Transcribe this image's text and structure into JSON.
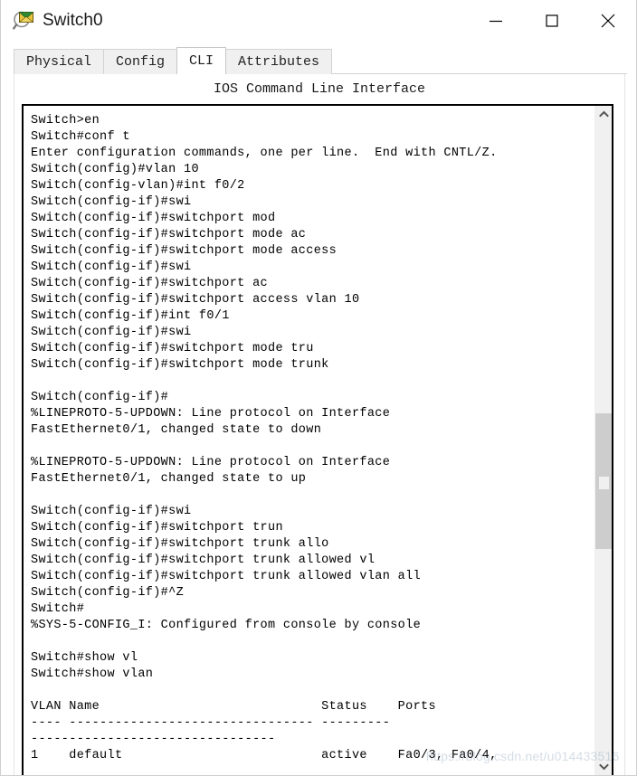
{
  "window": {
    "title": "Switch0",
    "icon": "packet-tracer-device-icon",
    "controls": {
      "minimize": "—",
      "maximize": "□",
      "close": "✕"
    }
  },
  "tabs": [
    {
      "label": "Physical",
      "active": false
    },
    {
      "label": "Config",
      "active": false
    },
    {
      "label": "CLI",
      "active": true
    },
    {
      "label": "Attributes",
      "active": false
    }
  ],
  "panel": {
    "heading": "IOS Command Line Interface"
  },
  "terminal": {
    "lines": [
      "Switch>en",
      "Switch#conf t",
      "Enter configuration commands, one per line.  End with CNTL/Z.",
      "Switch(config)#vlan 10",
      "Switch(config-vlan)#int f0/2",
      "Switch(config-if)#swi",
      "Switch(config-if)#switchport mod",
      "Switch(config-if)#switchport mode ac",
      "Switch(config-if)#switchport mode access",
      "Switch(config-if)#swi",
      "Switch(config-if)#switchport ac",
      "Switch(config-if)#switchport access vlan 10",
      "Switch(config-if)#int f0/1",
      "Switch(config-if)#swi",
      "Switch(config-if)#switchport mode tru",
      "Switch(config-if)#switchport mode trunk",
      "",
      "Switch(config-if)#",
      "%LINEPROTO-5-UPDOWN: Line protocol on Interface",
      "FastEthernet0/1, changed state to down",
      "",
      "%LINEPROTO-5-UPDOWN: Line protocol on Interface",
      "FastEthernet0/1, changed state to up",
      "",
      "Switch(config-if)#swi",
      "Switch(config-if)#switchport trun",
      "Switch(config-if)#switchport trunk allo",
      "Switch(config-if)#switchport trunk allowed vl",
      "Switch(config-if)#switchport trunk allowed vlan all",
      "Switch(config-if)#^Z",
      "Switch#",
      "%SYS-5-CONFIG_I: Configured from console by console",
      "",
      "Switch#show vl",
      "Switch#show vlan",
      "",
      "VLAN Name                             Status    Ports",
      "---- -------------------------------- ---------",
      "--------------------------------",
      "1    default                          active    Fa0/3, Fa0/4,"
    ]
  },
  "scrollbar": {
    "up_arrow": "⌃",
    "down_arrow": "⌄"
  },
  "watermark": {
    "text": "https://blog.csdn.net/u014433516"
  }
}
